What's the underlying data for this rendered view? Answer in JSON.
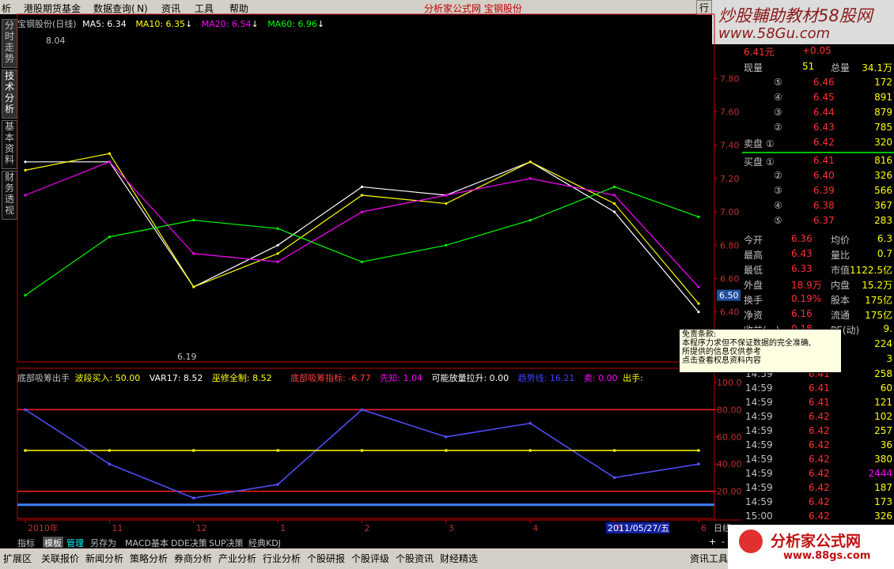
{
  "menu": [
    "析",
    "港股期货基金",
    "数据查询( N)",
    "资讯",
    "工具",
    "帮助"
  ],
  "menu_center": "分析家公式网 宝钢股份",
  "menu_right": "行",
  "watermark": {
    "line1": "炒股輔助教材58股网",
    "line2": "www.58Gu.com"
  },
  "side_tabs": [
    "分时走势",
    "技术分析",
    "基本资料",
    "财务透视"
  ],
  "price_header": {
    "stock": "宝钢股份(日线)",
    "ma5": "MA5: 6.34",
    "ma10": "MA10: 6.35",
    "ma20": "MA20: 6.54",
    "ma60": "MA60: 6.96",
    "arrow": "↓"
  },
  "colors": {
    "ma5": "#ffffff",
    "ma10": "#ffff00",
    "ma20": "#ff00ff",
    "ma60": "#00ff00",
    "up": "#ff3232",
    "down": "#54ffff",
    "axis_red": "#c00000"
  },
  "price_axis": [
    "7.80",
    "7.60",
    "7.40",
    "7.20",
    "7.00",
    "6.80",
    "6.60",
    "6.40"
  ],
  "price_marker": "6.50",
  "annot_high": "8.04",
  "annot_low": "6.19",
  "indicator_header": {
    "name": "底部吸筹出手",
    "a": "波段买入: 50.00",
    "b": "VAR17: 8.52",
    "c": "巫修全制: 8.52",
    "d": "底部吸筹指标: -6.77",
    "e": "先知: 1.04",
    "f": "可能放量拉升: 0.00",
    "g": "趋势线: 16.21",
    "h": "卖: 0.00",
    "i": "出手:"
  },
  "indicator_axis": [
    "100.00",
    "80.00",
    "60.00",
    "40.00",
    "20.00"
  ],
  "date_axis": [
    "2010年",
    "11",
    "12",
    "1",
    "2",
    "3",
    "4",
    "5",
    "6"
  ],
  "date_highlight": "2011/05/27/五",
  "period_label": "日线",
  "quote": {
    "price_top": "6.41元",
    "change_top": "+0.05",
    "xianliang_label": "现量",
    "xianliang": "51",
    "zongliang_label": "总量",
    "zongliang": "34.1万",
    "sell": [
      {
        "lvl": "⑤",
        "price": "6.46",
        "vol": "172"
      },
      {
        "lvl": "④",
        "price": "6.45",
        "vol": "891"
      },
      {
        "lvl": "③",
        "price": "6.44",
        "vol": "879"
      },
      {
        "lvl": "②",
        "price": "6.43",
        "vol": "785"
      },
      {
        "lvl": "卖盘 ①",
        "price": "6.42",
        "vol": "320"
      }
    ],
    "buy": [
      {
        "lvl": "买盘 ①",
        "price": "6.41",
        "vol": "816"
      },
      {
        "lvl": "②",
        "price": "6.40",
        "vol": "326"
      },
      {
        "lvl": "③",
        "price": "6.39",
        "vol": "566"
      },
      {
        "lvl": "④",
        "price": "6.38",
        "vol": "367"
      },
      {
        "lvl": "⑤",
        "price": "6.37",
        "vol": "283"
      }
    ],
    "stats": [
      {
        "k1": "今开",
        "v1": "6.36",
        "k2": "均价",
        "v2": "6.3"
      },
      {
        "k1": "最高",
        "v1": "6.43",
        "k2": "量比",
        "v2": "0.7"
      },
      {
        "k1": "最低",
        "v1": "6.33",
        "k2": "市值",
        "v2": "1122.5亿"
      },
      {
        "k1": "外盘",
        "v1": "18.9万",
        "k2": "内盘",
        "v2": "15.2万"
      },
      {
        "k1": "换手",
        "v1": "0.19%",
        "k2": "股本",
        "v2": "175亿"
      },
      {
        "k1": "净资",
        "v1": "6.16",
        "k2": "流通",
        "v2": "175亿"
      },
      {
        "k1": "收益(一)",
        "v1": "0.18",
        "k2": "PE(动)",
        "v2": "9."
      }
    ],
    "ticks_top": [
      "224",
      "3"
    ],
    "ticks": [
      {
        "t": "14:59",
        "p": "6.41",
        "v": "258"
      },
      {
        "t": "14:59",
        "p": "6.41",
        "v": "60"
      },
      {
        "t": "14:59",
        "p": "6.41",
        "v": "121"
      },
      {
        "t": "14:59",
        "p": "6.42",
        "v": "102"
      },
      {
        "t": "14:59",
        "p": "6.42",
        "v": "257"
      },
      {
        "t": "14:59",
        "p": "6.42",
        "v": "36"
      },
      {
        "t": "14:59",
        "p": "6.42",
        "v": "380"
      },
      {
        "t": "14:59",
        "p": "6.42",
        "v": "2444"
      },
      {
        "t": "14:59",
        "p": "6.42",
        "v": "187"
      },
      {
        "t": "14:59",
        "p": "6.42",
        "v": "173"
      },
      {
        "t": "15:00",
        "p": "6.42",
        "v": "326"
      }
    ]
  },
  "disclaimer": {
    "title": "免责条款:",
    "l1": "本程序力求但不保证数据的完全准确,",
    "l2": "所提供的信息仅供参考",
    "l3": "点击查看权息资料内容"
  },
  "bottom_tabs": [
    "指标",
    "模板",
    "管理",
    "另存为",
    "MACD基本",
    "DDE决策",
    "SUP决策",
    "经典KDJ"
  ],
  "bottom_bar": [
    "扩展区",
    "关联报价",
    "新闻分析",
    "策略分析",
    "券商分析",
    "产业分析",
    "行业分析",
    "个股研报",
    "个股评级",
    "个股资讯",
    "财经精选",
    "资讯工具"
  ],
  "logo2": {
    "name": "分析家公式网",
    "url": "www.88gs.com"
  },
  "chart_data": [
    {
      "type": "line",
      "title": "宝钢股份(日线)",
      "xlabel": "",
      "ylabel": "",
      "ylim": [
        6.1,
        8.1
      ],
      "x": [
        "2010年",
        "11",
        "12",
        "1",
        "2",
        "3",
        "4",
        "5",
        "6"
      ],
      "series": [
        {
          "name": "MA5",
          "values": [
            7.3,
            7.3,
            6.55,
            6.8,
            7.15,
            7.1,
            7.3,
            7.0,
            6.4
          ]
        },
        {
          "name": "MA10",
          "values": [
            7.25,
            7.35,
            6.55,
            6.75,
            7.1,
            7.05,
            7.3,
            7.05,
            6.45
          ]
        },
        {
          "name": "MA20",
          "values": [
            7.1,
            7.3,
            6.75,
            6.7,
            7.0,
            7.1,
            7.2,
            7.1,
            6.55
          ]
        },
        {
          "name": "MA60",
          "values": [
            6.5,
            6.85,
            6.95,
            6.9,
            6.7,
            6.8,
            6.95,
            7.15,
            6.97
          ]
        }
      ],
      "annotations": [
        "8.04",
        "6.19"
      ]
    },
    {
      "type": "line",
      "title": "底部吸筹出手",
      "ylim": [
        0,
        100
      ],
      "x": [
        "2010年",
        "11",
        "12",
        "1",
        "2",
        "3",
        "4",
        "5",
        "6"
      ],
      "series": [
        {
          "name": "趋势线",
          "values": [
            80,
            40,
            15,
            25,
            80,
            60,
            70,
            30,
            40
          ]
        },
        {
          "name": "波段买入",
          "values": [
            50,
            50,
            50,
            50,
            50,
            50,
            50,
            50,
            50
          ]
        }
      ]
    }
  ]
}
